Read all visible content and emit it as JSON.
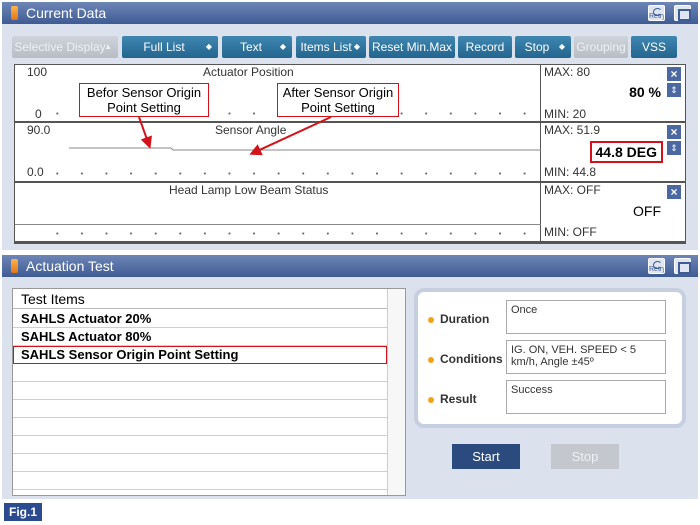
{
  "current_data": {
    "title": "Current Data",
    "retry_label": "Retry",
    "toolbar": {
      "selective_display": "Selective Display",
      "full_list": "Full List",
      "text": "Text",
      "items_list": "Items List",
      "reset_min_max": "Reset Min.Max",
      "record": "Record",
      "stop": "Stop",
      "grouping": "Grouping",
      "vss": "VSS"
    },
    "rows": [
      {
        "name": "Actuator Position",
        "scale_max": "100",
        "scale_min": "0",
        "max": "MAX: 80",
        "min": "MIN: 20",
        "value": "80 %"
      },
      {
        "name": "Sensor Angle",
        "scale_max": "90.0",
        "scale_min": "0.0",
        "max": "MAX: 51.9",
        "min": "MIN: 44.8",
        "value": "44.8 DEG"
      },
      {
        "name": "Head Lamp Low Beam Status",
        "max": "MAX: OFF",
        "min": "MIN: OFF",
        "value": "OFF"
      }
    ],
    "callouts": {
      "before": "Befor Sensor Origin Point Setting",
      "after": "After Sensor Origin Point Setting"
    }
  },
  "actuation_test": {
    "title": "Actuation Test",
    "items_header": "Test Items",
    "items": [
      "SAHLS Actuator 20%",
      "SAHLS Actuator 80%",
      "SAHLS Sensor Origin Point Setting"
    ],
    "duration_label": "Duration",
    "duration_value": "Once",
    "conditions_label": "Conditions",
    "conditions_value": "IG. ON, VEH. SPEED < 5 km/h, Angle ±45º",
    "result_label": "Result",
    "result_value": "Success",
    "start_label": "Start",
    "stop_label": "Stop"
  },
  "figure_label": "Fig.1",
  "colors": {
    "title_bar": "#4a659c",
    "toolbar_button": "#2f76a1",
    "highlight": "#d4121a",
    "panel_bg": "#dbe2ee",
    "start_button": "#2b4a7e",
    "stop_button": "#c4c8ce"
  }
}
